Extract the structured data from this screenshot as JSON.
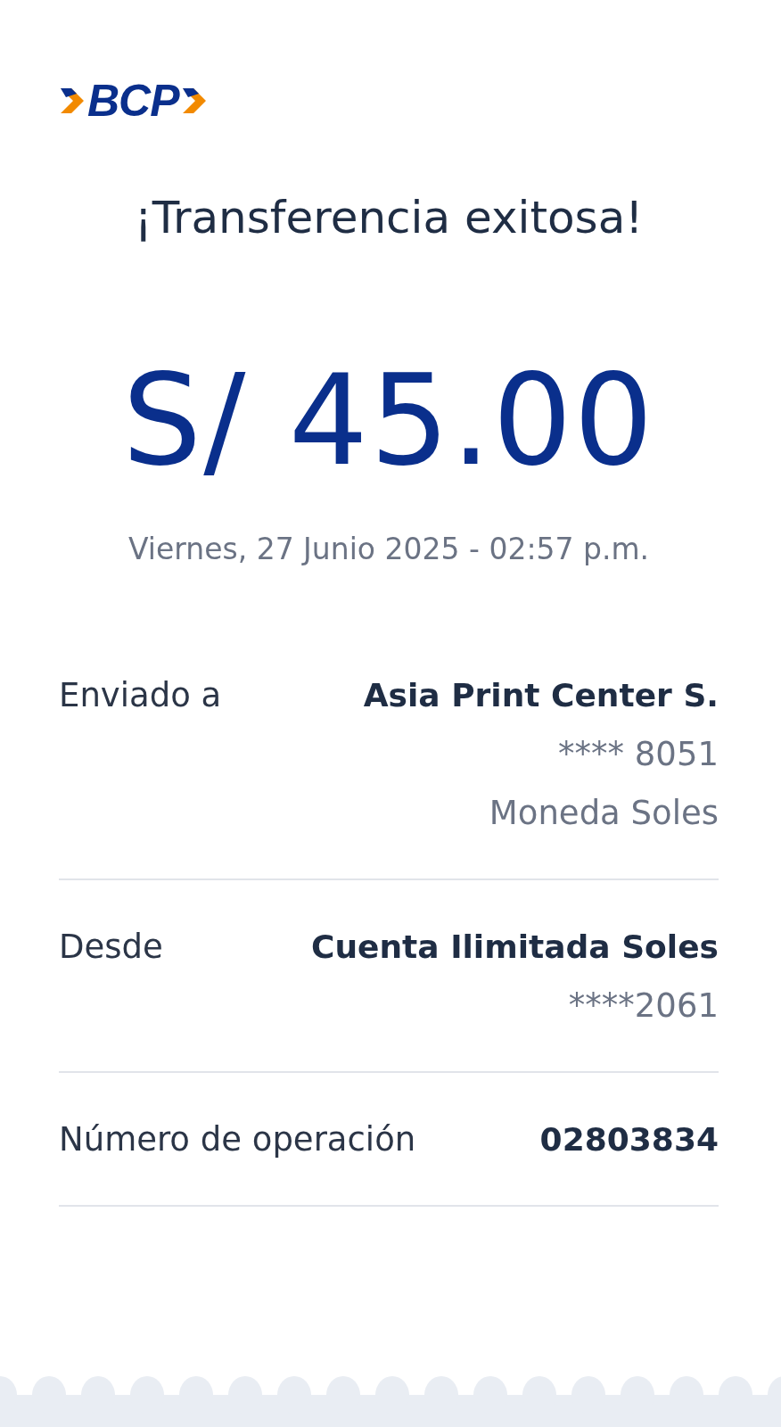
{
  "logo": {
    "text": "BCP"
  },
  "title": "¡Transferencia exitosa!",
  "amount": "S/ 45.00",
  "date": "Viernes, 27 Junio 2025 - 02:57 p.m.",
  "details": [
    {
      "label": "Enviado a",
      "lines": [
        {
          "text": "Asia Print Center S.",
          "kind": "strong"
        },
        {
          "text": "**** 8051",
          "kind": "muted"
        },
        {
          "text": "Moneda Soles",
          "kind": "muted"
        }
      ]
    },
    {
      "label": "Desde",
      "lines": [
        {
          "text": "Cuenta Ilimitada Soles",
          "kind": "strong"
        },
        {
          "text": "****2061",
          "kind": "muted"
        }
      ]
    },
    {
      "label": "Número de operación",
      "lines": [
        {
          "text": "02803834",
          "kind": "strong"
        }
      ]
    }
  ]
}
